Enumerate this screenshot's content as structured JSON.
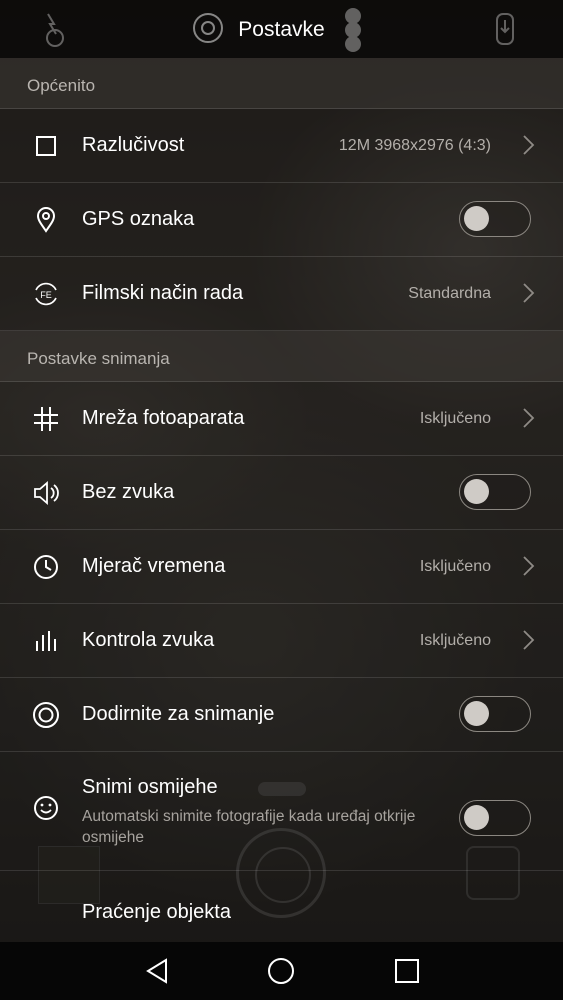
{
  "header": {
    "title": "Postavke"
  },
  "sections": [
    {
      "title": "Općenito"
    },
    {
      "title": "Postavke snimanja"
    }
  ],
  "settings": {
    "resolution": {
      "label": "Razlučivost",
      "value": "12M 3968x2976 (4:3)"
    },
    "gps": {
      "label": "GPS oznaka",
      "on": false
    },
    "film_mode": {
      "label": "Filmski način rada",
      "value": "Standardna",
      "icon_text": "FE"
    },
    "grid": {
      "label": "Mreža fotoaparata",
      "value": "Isključeno"
    },
    "mute": {
      "label": "Bez zvuka",
      "on": false
    },
    "timer": {
      "label": "Mjerač vremena",
      "value": "Isključeno"
    },
    "audio_control": {
      "label": "Kontrola zvuka",
      "value": "Isključeno"
    },
    "touch_capture": {
      "label": "Dodirnite za snimanje",
      "on": false
    },
    "smile_capture": {
      "label": "Snimi osmijehe",
      "description": "Automatski snimite fotografije kada uređaj otkrije osmijehe",
      "on": false
    },
    "object_tracking": {
      "label": "Praćenje objekta"
    }
  },
  "icons": {
    "resolution": "square-icon",
    "gps": "location-pin-icon",
    "film_mode": "fe-icon",
    "grid": "grid-icon",
    "mute": "speaker-icon",
    "timer": "clock-icon",
    "audio_control": "equalizer-icon",
    "touch_capture": "touch-target-icon",
    "smile_capture": "smile-icon"
  },
  "colors": {
    "header_bg": "#0c0b0a",
    "toggle_knob": "#cfcbc6",
    "secondary_text": "#b3afaa"
  }
}
